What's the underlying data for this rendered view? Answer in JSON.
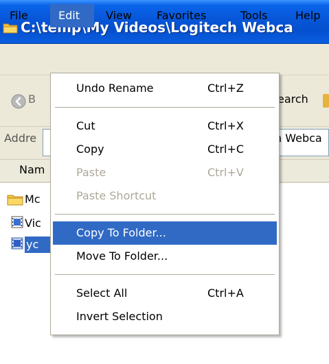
{
  "window": {
    "title": "C:\\temp\\My Videos\\Logitech Webca"
  },
  "menubar": {
    "items": [
      {
        "label": "File"
      },
      {
        "label": "Edit"
      },
      {
        "label": "View"
      },
      {
        "label": "Favorites"
      },
      {
        "label": "Tools"
      },
      {
        "label": "Help"
      }
    ],
    "active": "Edit"
  },
  "toolbar": {
    "back_label": "B",
    "search_label": "earch"
  },
  "address": {
    "label": "Addre",
    "value": "n Webca"
  },
  "filelist": {
    "column_header": "Nam",
    "rows": [
      {
        "icon": "folder-icon",
        "name": "Mc",
        "selected": false
      },
      {
        "icon": "video-file-icon",
        "name": "Vic",
        "selected": false
      },
      {
        "icon": "video-file-icon",
        "name": "yc",
        "selected": true
      }
    ]
  },
  "edit_menu": {
    "items": [
      {
        "label": "Undo Rename",
        "shortcut": "Ctrl+Z",
        "enabled": true
      },
      {
        "label": "Cut",
        "shortcut": "Ctrl+X",
        "enabled": true
      },
      {
        "label": "Copy",
        "shortcut": "Ctrl+C",
        "enabled": true
      },
      {
        "label": "Paste",
        "shortcut": "Ctrl+V",
        "enabled": false
      },
      {
        "label": "Paste Shortcut",
        "shortcut": "",
        "enabled": false
      },
      {
        "label": "Copy To Folder...",
        "shortcut": "",
        "enabled": true,
        "highlighted": true
      },
      {
        "label": "Move To Folder...",
        "shortcut": "",
        "enabled": true
      },
      {
        "label": "Select All",
        "shortcut": "Ctrl+A",
        "enabled": true
      },
      {
        "label": "Invert Selection",
        "shortcut": "",
        "enabled": true
      }
    ]
  },
  "colors": {
    "titlebar_blue": "#0a5ee0",
    "menu_face": "#ece9d8",
    "selection_blue": "#316ac5",
    "disabled_text": "#aca899"
  }
}
